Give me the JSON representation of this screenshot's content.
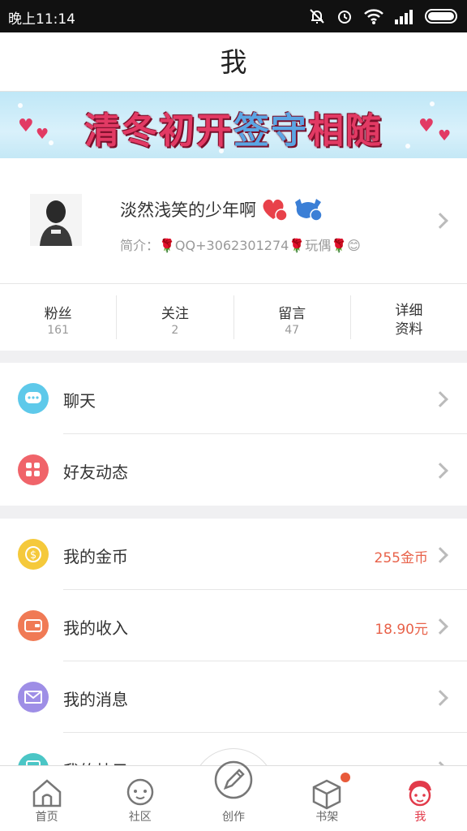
{
  "status_bar": {
    "time": "晚上11:14"
  },
  "header": {
    "title": "我"
  },
  "banner": {
    "text_red": "清冬初开",
    "text_blue": "签守",
    "text_red2": "相随"
  },
  "profile": {
    "nickname": "淡然浅笑的少年啊",
    "badge_heart_level": "1",
    "badge_tag": "墙",
    "badge_tag_level": "1",
    "bio": "简介：🌹QQ+3062301274🌹玩偶🌹😊"
  },
  "stats": [
    {
      "label": "粉丝",
      "value": "161"
    },
    {
      "label": "关注",
      "value": "2"
    },
    {
      "label": "留言",
      "value": "47"
    },
    {
      "label": "详细资料",
      "value": ""
    }
  ],
  "menu_group1": [
    {
      "label": "聊天",
      "icon": "chat-bubble-icon",
      "color": "#5ec9ea"
    },
    {
      "label": "好友动态",
      "icon": "grid-icon",
      "color": "#f0646a"
    }
  ],
  "menu_group2": [
    {
      "label": "我的金币",
      "icon": "coin-icon",
      "color": "#f5c93b",
      "value": "255金币"
    },
    {
      "label": "我的收入",
      "icon": "wallet-icon",
      "color": "#f07a55",
      "value": "18.90元"
    },
    {
      "label": "我的消息",
      "icon": "envelope-icon",
      "color": "#9e8ee6",
      "value": ""
    },
    {
      "label": "我的帖子",
      "icon": "doc-icon",
      "color": "#4bc6c6",
      "value": ""
    }
  ],
  "tabs": [
    {
      "label": "首页",
      "icon": "home-icon"
    },
    {
      "label": "社区",
      "icon": "community-icon"
    },
    {
      "label": "创作",
      "icon": "pen-icon"
    },
    {
      "label": "书架",
      "icon": "bookshelf-icon"
    },
    {
      "label": "我",
      "icon": "me-icon"
    }
  ],
  "colors": {
    "accent": "#e23a4a",
    "value_text": "#e8624a"
  }
}
